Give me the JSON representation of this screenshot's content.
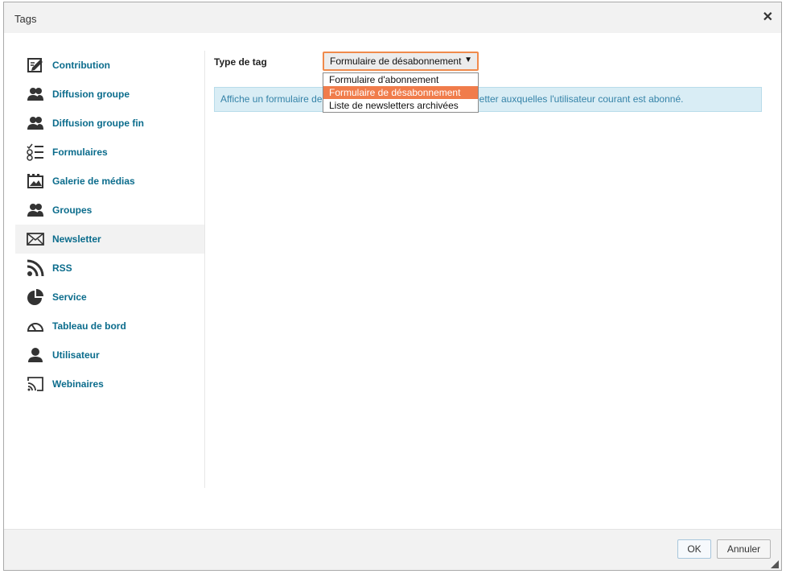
{
  "window": {
    "title": "Tags"
  },
  "sidebar": {
    "items": [
      {
        "label": "Contribution",
        "icon": "edit-icon"
      },
      {
        "label": "Diffusion groupe",
        "icon": "group-icon"
      },
      {
        "label": "Diffusion groupe fin",
        "icon": "group-icon"
      },
      {
        "label": "Formulaires",
        "icon": "form-list-icon"
      },
      {
        "label": "Galerie de médias",
        "icon": "media-gallery-icon"
      },
      {
        "label": "Groupes",
        "icon": "group-icon"
      },
      {
        "label": "Newsletter",
        "icon": "envelope-icon"
      },
      {
        "label": "RSS",
        "icon": "rss-icon"
      },
      {
        "label": "Service",
        "icon": "pie-chart-icon"
      },
      {
        "label": "Tableau de bord",
        "icon": "gauge-icon"
      },
      {
        "label": "Utilisateur",
        "icon": "user-icon"
      },
      {
        "label": "Webinaires",
        "icon": "cast-icon"
      }
    ],
    "active_index": 6
  },
  "main": {
    "type_label": "Type de tag",
    "select": {
      "value": "Formulaire de désabonnement",
      "options": [
        "Formulaire d'abonnement",
        "Formulaire de désabonnement",
        "Liste de newsletters archivées"
      ],
      "selected_index": 1
    },
    "info_text_visible_left": "Affiche un formulaire de",
    "info_text_visible_right": "letter auxquelles l'utilisateur courant est abonné."
  },
  "footer": {
    "ok_label": "OK",
    "cancel_label": "Annuler"
  },
  "colors": {
    "link": "#0b6c8c",
    "accent": "#f07c4b",
    "info_bg": "#d9edf5",
    "info_text": "#3583a8"
  }
}
